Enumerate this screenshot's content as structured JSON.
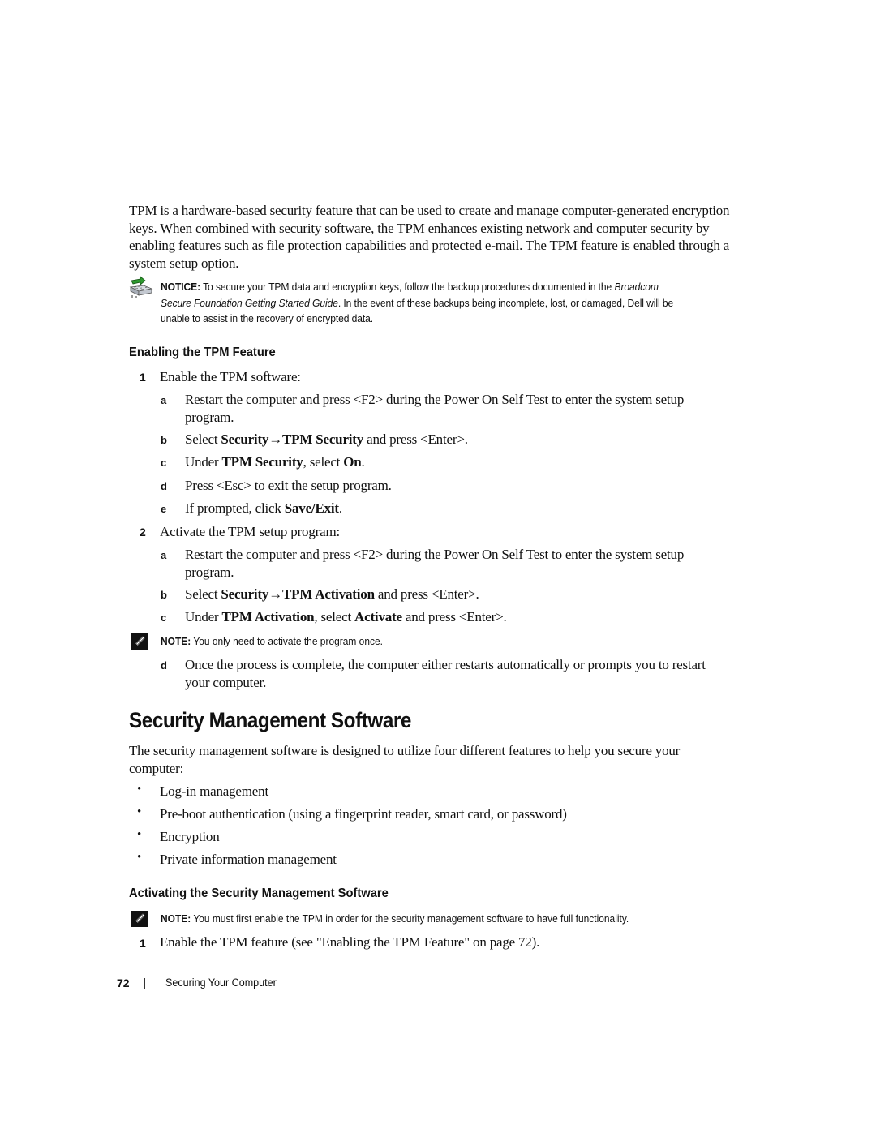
{
  "intro": {
    "paragraph": "TPM is a hardware-based security feature that can be used to create and manage computer-generated encryption keys. When combined with security software, the TPM enhances existing network and computer security by enabling features such as file protection capabilities and protected e-mail. The TPM feature is enabled through a system setup option."
  },
  "notice": {
    "icon": "notice-hardware-icon",
    "label": "NOTICE:",
    "text_before": " To secure your TPM data and encryption keys, follow the backup procedures documented in the ",
    "guide_title": "Broadcom Secure Foundation Getting Started Guide",
    "text_after": ". In the event of these backups being incomplete, lost, or damaged, Dell will be unable to assist in the recovery of encrypted data."
  },
  "enabling_section": {
    "heading": "Enabling the TPM Feature",
    "steps": [
      {
        "num": "1",
        "text": "Enable the TPM software:",
        "substeps": [
          {
            "letter": "a",
            "line1": "Restart the computer and press <F2> during the Power On Self Test to enter the system setup",
            "line2": "program."
          },
          {
            "letter": "b",
            "pre": "Select ",
            "bold1": "Security→TPM Security",
            "post": " and press <Enter>."
          },
          {
            "letter": "c",
            "pre": "Under ",
            "bold1": "TPM Security",
            "mid": ", select ",
            "bold2": "On",
            "post": "."
          },
          {
            "letter": "d",
            "text": "Press <Esc> to exit the setup program."
          },
          {
            "letter": "e",
            "pre": "If prompted, click ",
            "bold1": "Save/Exit",
            "post": "."
          }
        ]
      },
      {
        "num": "2",
        "text": "Activate the TPM setup program:",
        "substeps": [
          {
            "letter": "a",
            "line1": "Restart the computer and press <F2> during the Power On Self Test to enter the system setup",
            "line2": "program."
          },
          {
            "letter": "b",
            "pre": "Select ",
            "bold1": "Security→TPM Activation",
            "post": " and press <Enter>."
          },
          {
            "letter": "c",
            "pre": "Under ",
            "bold1": "TPM Activation",
            "mid": ", select ",
            "bold2": "Activate",
            "post": " and press <Enter>."
          },
          {
            "letter": "d",
            "line1": "Once the process is complete, the computer either restarts automatically or prompts you to restart",
            "line2": "your computer."
          }
        ]
      }
    ],
    "note": {
      "icon": "note-pencil-icon",
      "label": "NOTE:",
      "text": " You only need to activate the program once."
    }
  },
  "security_section": {
    "heading": "Security Management Software",
    "paragraph_line1": "The security management software is designed to utilize four different features to help you secure your",
    "paragraph_line2": "computer:",
    "features": [
      "Log-in management",
      "Pre-boot authentication (using a fingerprint reader, smart card, or password)",
      "Encryption",
      "Private information management"
    ],
    "bullet_glyph": "•"
  },
  "activating_section": {
    "heading": "Activating the Security Management Software",
    "note": {
      "icon": "note-pencil-icon",
      "label": "NOTE:",
      "text": " You must first enable the TPM in order for the security management software to have full functionality."
    },
    "steps": [
      {
        "num": "1",
        "text": "Enable the TPM feature (see \"Enabling the TPM Feature\" on page 72)."
      }
    ]
  },
  "footer": {
    "page_number": "72",
    "section_title": "Securing Your Computer"
  }
}
